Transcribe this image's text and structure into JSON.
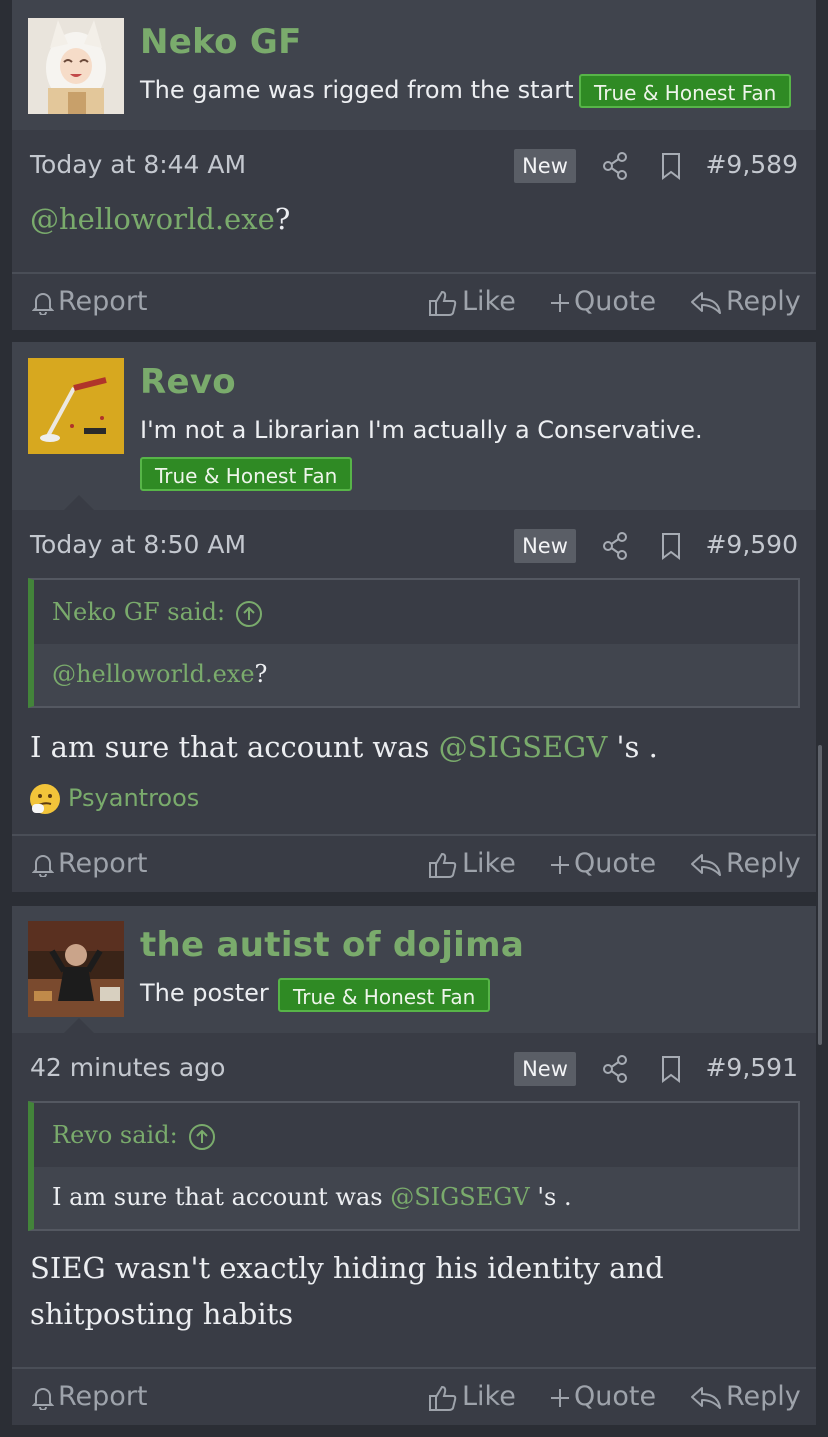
{
  "posts": [
    {
      "username": "Neko GF",
      "user_title": "The game was rigged from the start",
      "badge": "True & Honest Fan",
      "time": "Today at 8:44 AM",
      "new_label": "New",
      "number": "#9,589",
      "body_mention": "@helloworld.exe",
      "body_suffix": "?",
      "actions": {
        "report": "Report",
        "like": "Like",
        "quote": "Quote",
        "reply": "Reply"
      }
    },
    {
      "username": "Revo",
      "user_title": "I'm not a Librarian I'm actually a Conservative.",
      "badge": "True & Honest Fan",
      "time": "Today at 8:50 AM",
      "new_label": "New",
      "number": "#9,590",
      "quote": {
        "author": "Neko GF said:",
        "mention": "@helloworld.exe",
        "suffix": "?"
      },
      "body_prefix": "I am sure that account was ",
      "body_mention": "@SIGSEGV",
      "body_suffix": " 's .",
      "reaction_user": "Psyantroos",
      "actions": {
        "report": "Report",
        "like": "Like",
        "quote": "Quote",
        "reply": "Reply"
      }
    },
    {
      "username": "the autist of dojima",
      "user_title": "The poster",
      "badge": "True & Honest Fan",
      "time": "42 minutes ago",
      "new_label": "New",
      "number": "#9,591",
      "quote": {
        "author": "Revo said:",
        "prefix": "I am sure that account was ",
        "mention": "@SIGSEGV",
        "suffix": " 's ."
      },
      "body_line1": "SIEG wasn't exactly hiding his identity and",
      "body_line2": "shitposting habits",
      "actions": {
        "report": "Report",
        "like": "Like",
        "quote": "Quote",
        "reply": "Reply"
      }
    }
  ],
  "colors": {
    "accent": "#7aab6c",
    "badge_bg": "#2f8a24",
    "post_bg": "#393c45",
    "header_bg": "#40444d"
  }
}
